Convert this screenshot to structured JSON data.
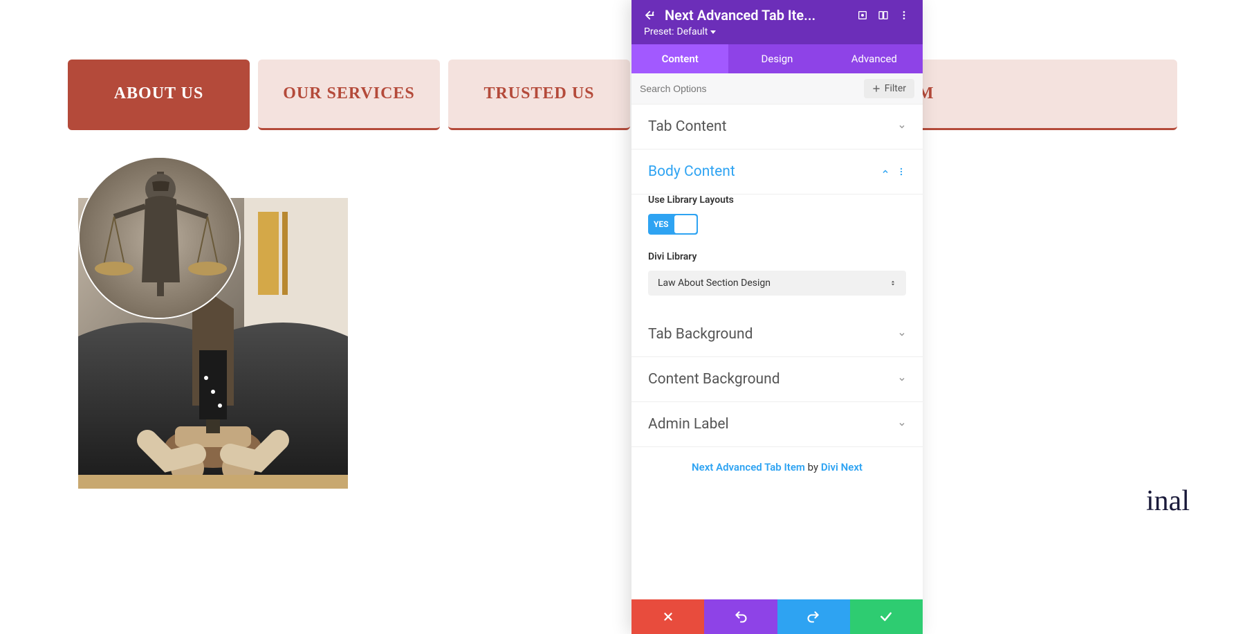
{
  "tabs": {
    "items": [
      {
        "label": "ABOUT US",
        "active": true
      },
      {
        "label": "OUR SERVICES",
        "active": false
      },
      {
        "label": "TRUSTED US",
        "active": false
      },
      {
        "label": "TEAM",
        "active": false
      }
    ]
  },
  "hidden_behind_panel_text": "inal",
  "panel": {
    "title": "Next Advanced Tab Ite...",
    "preset_label": "Preset:",
    "preset_value": "Default",
    "tabs": {
      "content": "Content",
      "design": "Design",
      "advanced": "Advanced"
    },
    "search_placeholder": "Search Options",
    "filter_label": "Filter",
    "sections": {
      "tab_content": "Tab Content",
      "body_content": "Body Content",
      "tab_background": "Tab Background",
      "content_background": "Content Background",
      "admin_label": "Admin Label"
    },
    "body_content": {
      "use_library_label": "Use Library Layouts",
      "toggle_value": "YES",
      "divi_library_label": "Divi Library",
      "divi_library_value": "Law About Section Design"
    },
    "credits": {
      "module_name": "Next Advanced Tab Item",
      "by": " by ",
      "author": "Divi Next"
    }
  },
  "icons": {
    "back": "back-icon",
    "expand": "expand-icon",
    "columns": "columns-icon",
    "menu": "menu-dots-icon",
    "plus": "plus-icon",
    "chevron_down": "chevron-down-icon",
    "chevron_up": "chevron-up-icon",
    "dots_v": "dots-vertical-icon",
    "sort": "sort-icon",
    "close": "close-icon",
    "undo": "undo-icon",
    "redo": "redo-icon",
    "check": "check-icon"
  }
}
